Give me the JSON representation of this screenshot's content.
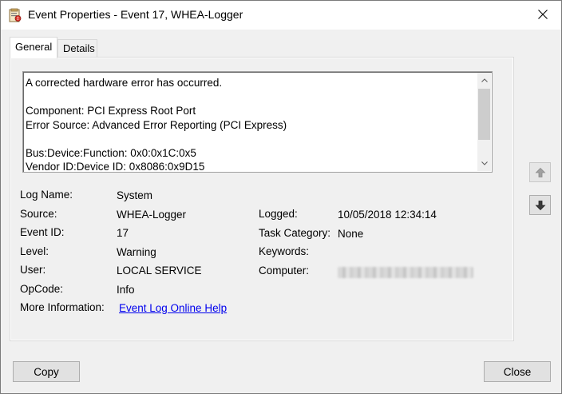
{
  "window": {
    "title": "Event Properties - Event 17, WHEA-Logger"
  },
  "tabs": [
    {
      "label": "General",
      "active": true
    },
    {
      "label": "Details",
      "active": false
    }
  ],
  "description": {
    "lines": [
      "A corrected hardware error has occurred.",
      "",
      "Component: PCI Express Root Port",
      "Error Source: Advanced Error Reporting (PCI Express)",
      "",
      "Bus:Device:Function: 0x0:0x1C:0x5",
      "Vendor ID:Device ID: 0x8086:0x9D15"
    ]
  },
  "fields": {
    "log_name": {
      "label": "Log Name:",
      "value": "System"
    },
    "source": {
      "label": "Source:",
      "value": "WHEA-Logger"
    },
    "logged": {
      "label": "Logged:",
      "value": "10/05/2018 12:34:14"
    },
    "event_id": {
      "label": "Event ID:",
      "value": "17"
    },
    "task_category": {
      "label": "Task Category:",
      "value": "None"
    },
    "level": {
      "label": "Level:",
      "value": "Warning"
    },
    "keywords": {
      "label": "Keywords:",
      "value": ""
    },
    "user": {
      "label": "User:",
      "value": "LOCAL SERVICE"
    },
    "computer": {
      "label": "Computer:"
    },
    "opcode": {
      "label": "OpCode:",
      "value": "Info"
    },
    "more_info": {
      "label": "More Information:",
      "link": "Event Log Online Help"
    }
  },
  "buttons": {
    "copy": "Copy",
    "close": "Close"
  },
  "icons": {
    "app": "event-viewer-icon",
    "close": "close-icon",
    "up": "arrow-up-icon",
    "down": "arrow-down-icon"
  }
}
